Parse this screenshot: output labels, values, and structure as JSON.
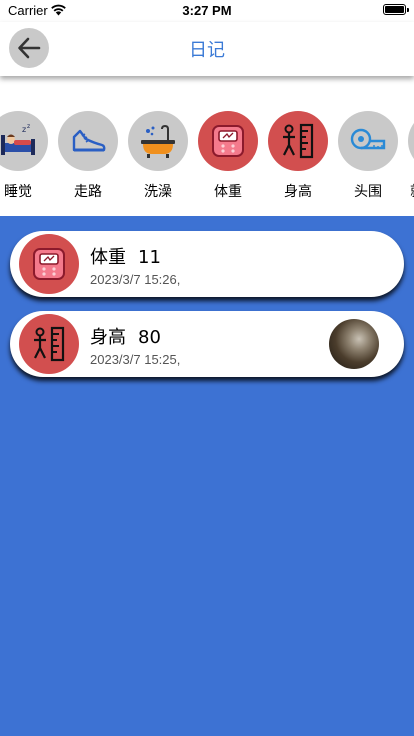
{
  "status_bar": {
    "carrier": "Carrier",
    "time": "3:27 PM"
  },
  "nav": {
    "title": "日记",
    "back_icon": "back-arrow-icon"
  },
  "categories": [
    {
      "label": "睡觉",
      "icon": "bed-icon"
    },
    {
      "label": "走路",
      "icon": "sneaker-icon"
    },
    {
      "label": "洗澡",
      "icon": "bathtub-icon"
    },
    {
      "label": "体重",
      "icon": "scale-icon",
      "active": true
    },
    {
      "label": "身高",
      "icon": "height-ruler-icon",
      "active": true
    },
    {
      "label": "头围",
      "icon": "tape-measure-icon"
    },
    {
      "label": "就",
      "icon": "partial-icon"
    }
  ],
  "records": [
    {
      "name": "体重",
      "value": "11",
      "time": "2023/3/7 15:26,",
      "icon": "scale-icon",
      "has_photo": false
    },
    {
      "name": "身高",
      "value": "80",
      "time": "2023/3/7 15:25,",
      "icon": "height-ruler-icon",
      "has_photo": true
    }
  ],
  "colors": {
    "accent": "#3b7ad6",
    "active_circle": "#d24f4f",
    "inactive_circle": "#c9c9c9",
    "content_bg": "#3d72d3"
  }
}
